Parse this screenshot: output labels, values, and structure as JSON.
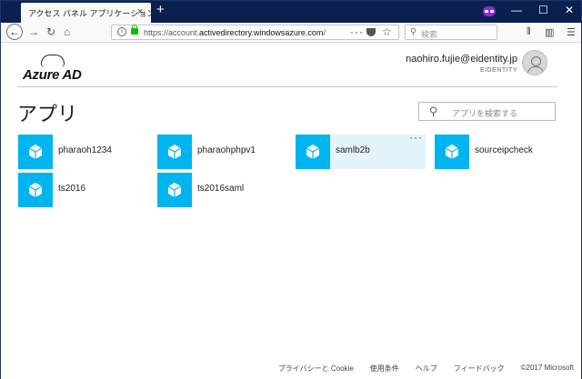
{
  "browser": {
    "tab_title": "アクセス パネル アプリケーション",
    "tab_close": "×",
    "new_tab": "+",
    "url_prefix": "https://account.",
    "url_domain": "activedirectory.windowsazure.com",
    "url_suffix": "/!",
    "search_placeholder": "検索",
    "window_controls": {
      "minimize": "—",
      "maximize": "☐",
      "close": "✕"
    },
    "icons": {
      "back": "back-arrow-icon",
      "forward": "forward-arrow-icon",
      "reload": "reload-icon",
      "home": "home-icon",
      "mask": "private-browsing-icon"
    }
  },
  "header": {
    "logo": "Azure AD",
    "user_email": "naohiro.fujie@eidentity.jp",
    "tenant": "EIDENTITY"
  },
  "main": {
    "title": "アプリ",
    "search_placeholder": "アプリを検索する",
    "tile_color": "#00b4f0",
    "apps": [
      {
        "label": "pharaoh1234",
        "selected": false
      },
      {
        "label": "pharaohphpv1",
        "selected": false
      },
      {
        "label": "samlb2b",
        "selected": true,
        "more": "···"
      },
      {
        "label": "sourceipcheck",
        "selected": false
      },
      {
        "label": "ts2016",
        "selected": false
      },
      {
        "label": "ts2016saml",
        "selected": false
      }
    ]
  },
  "footer": {
    "links": [
      "プライバシーと Cookie",
      "使用条件",
      "ヘルプ",
      "フィードバック"
    ],
    "copyright": "©2017 Microsoft"
  }
}
